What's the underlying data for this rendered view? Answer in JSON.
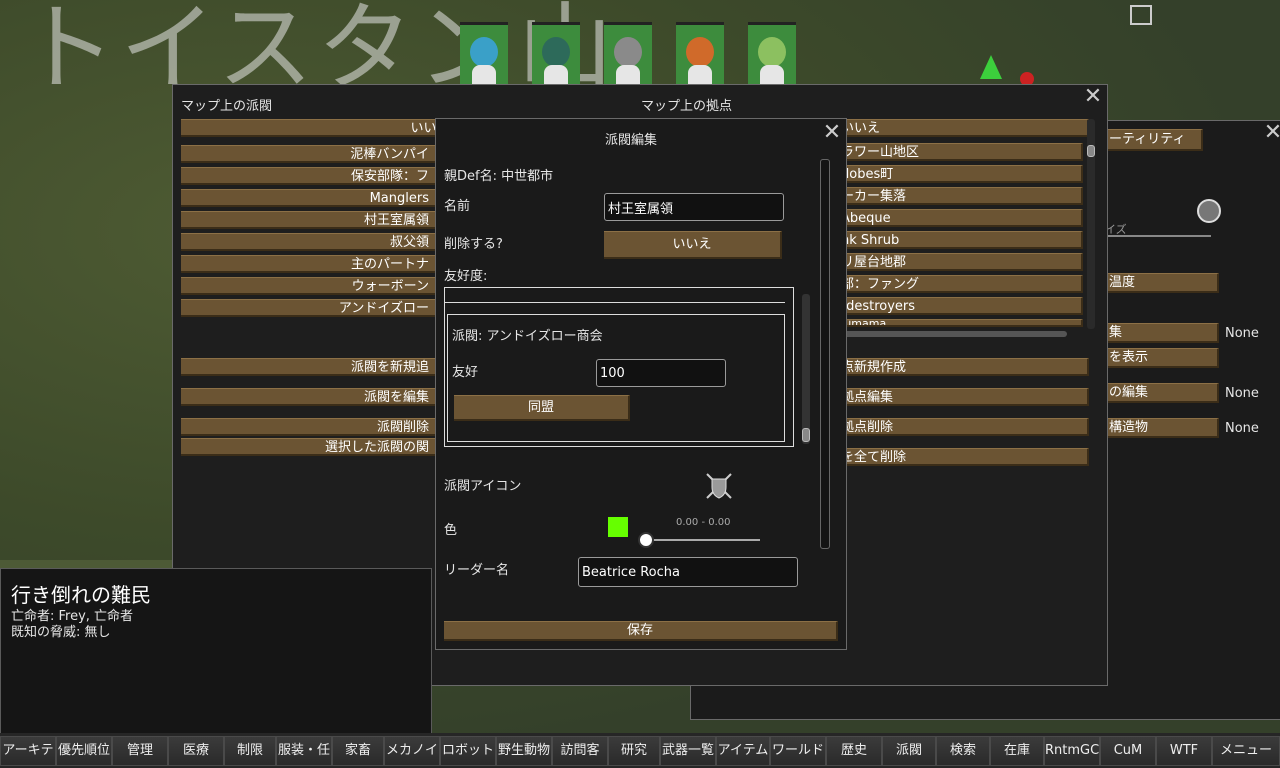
{
  "map": {
    "title": "トイスタン山"
  },
  "colors": {
    "button": "#6b5433",
    "panel": "#1e1e1e",
    "swatch": "#66ff00",
    "pawn_bg": "#3d8c3d"
  },
  "main_window": {
    "left_header": "マップ上の派閥",
    "right_header": "マップ上の拠点",
    "faction_list": [
      "いいえ",
      "泥棒バンパイ",
      "保安部隊：フ",
      "Manglers",
      "村王室属領",
      "叔父領",
      "主のパートナ",
      "ウォーボーン",
      "アンドイズロー"
    ],
    "faction_actions": [
      "派閥を新規追",
      "派閥を編集",
      "派閥削除",
      "選択した派閥の関"
    ],
    "base_list": [
      "いいえ",
      "ラワー山地区",
      "dobes町",
      "ーカー集落",
      "Abeque",
      "nk Shrub",
      "リ屋台地郡",
      "部：ファング",
      "tdestroyers",
      "Kimama"
    ],
    "base_actions": [
      "点新規作成",
      "拠点編集",
      "拠点削除",
      "を全て削除"
    ]
  },
  "right_panel": {
    "utility_btn": "ーティリティ",
    "size_label": "イズ",
    "temp_btn": "温度",
    "rows": [
      {
        "label": "集",
        "value": "None"
      },
      {
        "label": "を表示",
        "value": ""
      },
      {
        "label": "の編集",
        "value": "None"
      },
      {
        "label": "構造物",
        "value": "None"
      }
    ]
  },
  "dialog": {
    "title": "派閥編集",
    "parent_def": "親Def名: 中世都市",
    "name_label": "名前",
    "name_value": "村王室属領",
    "delete_label": "削除する?",
    "delete_value": "いいえ",
    "goodwill_label": "友好度:",
    "relation": {
      "faction_label": "派閥:  アンドイズロー商会",
      "goodwill_label": "友好",
      "goodwill_value": "100",
      "ally_btn": "同盟"
    },
    "icon_label": "派閥アイコン",
    "color_label": "色",
    "color_range": "0.00 - 0.00",
    "leader_label": "リーダー名",
    "leader_value": "Beatrice Rocha",
    "save_btn": "保存"
  },
  "info_panel": {
    "title": "行き倒れの難民",
    "line1": "亡命者: Frey, 亡命者",
    "line2": "既知の脅威: 無し"
  },
  "taskbar": [
    "アーキテ",
    "優先順位",
    "管理",
    "医療",
    "制限",
    "服装・任",
    "家畜",
    "メカノイ",
    "ロボット",
    "野生動物",
    "訪問客",
    "研究",
    "武器一覧",
    "アイテム",
    "ワールド",
    "歴史",
    "派閥",
    "検索",
    "在庫",
    "RntmGC",
    "CuM",
    "WTF",
    "メニュー"
  ]
}
